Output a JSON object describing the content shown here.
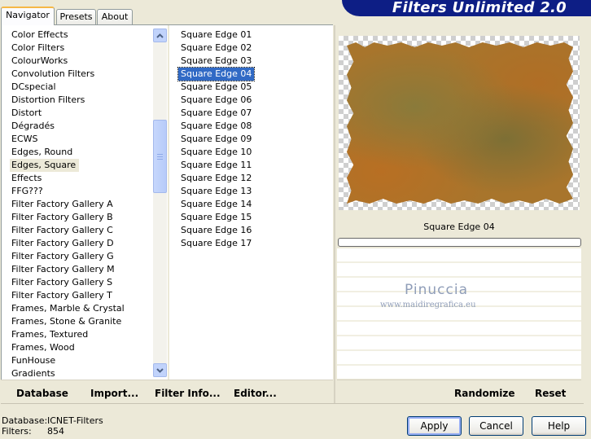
{
  "tabs": [
    "Navigator",
    "Presets",
    "About"
  ],
  "banner": {
    "title": "Filters Unlimited 2.0"
  },
  "categories": [
    "Color Effects",
    "Color Filters",
    "ColourWorks",
    "Convolution Filters",
    "DCspecial",
    "Distortion Filters",
    "Distort",
    "Dégradés",
    "ECWS",
    "Edges, Round",
    "Edges, Square",
    "Effects",
    "FFG???",
    "Filter Factory Gallery A",
    "Filter Factory Gallery B",
    "Filter Factory Gallery C",
    "Filter Factory Gallery D",
    "Filter Factory Gallery G",
    "Filter Factory Gallery M",
    "Filter Factory Gallery S",
    "Filter Factory Gallery T",
    "Frames, Marble & Crystal",
    "Frames, Stone & Granite",
    "Frames, Textured",
    "Frames, Wood",
    "FunHouse",
    "Gradients"
  ],
  "selected_category": "Edges, Square",
  "filters": [
    "Square Edge 01",
    "Square Edge 02",
    "Square Edge 03",
    "Square Edge 04",
    "Square Edge 05",
    "Square Edge 06",
    "Square Edge 07",
    "Square Edge 08",
    "Square Edge 09",
    "Square Edge 10",
    "Square Edge 11",
    "Square Edge 12",
    "Square Edge 13",
    "Square Edge 14",
    "Square Edge 15",
    "Square Edge 16",
    "Square Edge 17"
  ],
  "selected_filter": "Square Edge 04",
  "preview": {
    "filter_name": "Square Edge 04"
  },
  "watermark": {
    "title": "Pinuccia",
    "url": "www.maidiregrafica.eu"
  },
  "toolbar": {
    "database": "Database",
    "import": "Import...",
    "filter_info": "Filter Info...",
    "editor": "Editor...",
    "randomize": "Randomize",
    "reset": "Reset"
  },
  "status": {
    "database_label": "Database:",
    "database_value": "ICNET-Filters",
    "filters_label": "Filters:",
    "filters_value": "854"
  },
  "buttons": {
    "apply": "Apply",
    "cancel": "Cancel",
    "help": "Help"
  }
}
